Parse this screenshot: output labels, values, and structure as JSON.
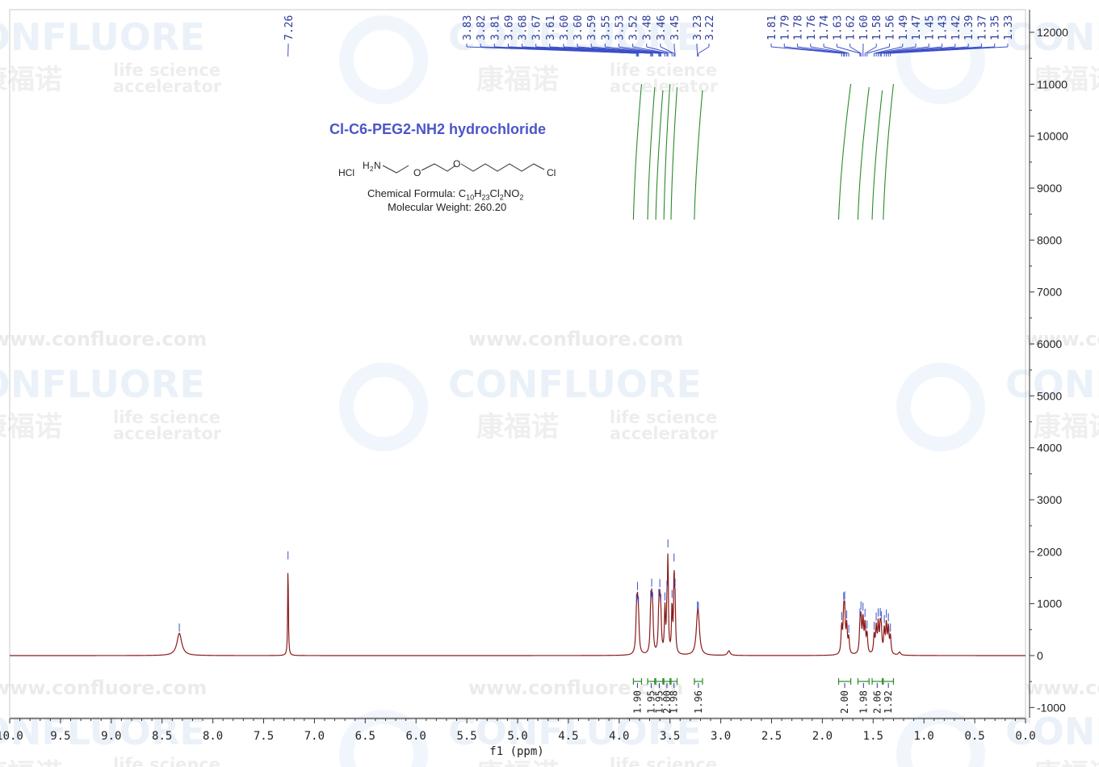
{
  "compound": {
    "title": "Cl-C6-PEG2-NH2 hydrochloride",
    "formula_prefix": "Chemical Formula: ",
    "formula_parts": [
      {
        "t": "C",
        "s": false
      },
      {
        "t": "10",
        "s": true
      },
      {
        "t": "H",
        "s": false
      },
      {
        "t": "23",
        "s": true
      },
      {
        "t": "Cl",
        "s": false
      },
      {
        "t": "2",
        "s": true
      },
      {
        "t": "NO",
        "s": false
      },
      {
        "t": "2",
        "s": true
      }
    ],
    "molecular_weight": "Molecular Weight: 260.20",
    "structure_labels": {
      "hcl": "HCl",
      "amine_h": "H",
      "amine_sub": "2",
      "amine_n": "N",
      "oxygen": "O",
      "chlorine": "Cl"
    }
  },
  "watermark": {
    "brand": "CONFLUORE",
    "url": "www.confluore.com",
    "tagline_1": "life science",
    "tagline_2": "accelerator",
    "chinese": "康福诺"
  },
  "chart_data": {
    "type": "line",
    "title": "",
    "xlabel": "f1 (ppm)",
    "ylabel": "",
    "xlim": [
      10.0,
      0.0
    ],
    "ylim": [
      -1200,
      12500
    ],
    "x_ticks": [
      "10.0",
      "9.5",
      "9.0",
      "8.5",
      "8.0",
      "7.5",
      "7.0",
      "6.5",
      "6.0",
      "5.5",
      "5.0",
      "4.5",
      "4.0",
      "3.5",
      "3.0",
      "2.5",
      "2.0",
      "1.5",
      "1.0",
      "0.5",
      "0.0"
    ],
    "y_ticks": [
      -1000,
      0,
      1000,
      2000,
      3000,
      4000,
      5000,
      6000,
      7000,
      8000,
      9000,
      10000,
      11000,
      12000
    ],
    "grid": false,
    "series": [
      {
        "color": "#8b1a1a",
        "peaks": [
          {
            "ppm": 8.33,
            "height": 430,
            "width": 0.028
          },
          {
            "ppm": 7.26,
            "height": 1820,
            "width": 0.004
          },
          {
            "ppm": 3.83,
            "height": 620,
            "width": 0.008
          },
          {
            "ppm": 3.82,
            "height": 760,
            "width": 0.008
          },
          {
            "ppm": 3.81,
            "height": 560,
            "width": 0.008
          },
          {
            "ppm": 3.69,
            "height": 700,
            "width": 0.007
          },
          {
            "ppm": 3.68,
            "height": 820,
            "width": 0.007
          },
          {
            "ppm": 3.67,
            "height": 650,
            "width": 0.007
          },
          {
            "ppm": 3.61,
            "height": 720,
            "width": 0.007
          },
          {
            "ppm": 3.6,
            "height": 800,
            "width": 0.007
          },
          {
            "ppm": 3.59,
            "height": 600,
            "width": 0.007
          },
          {
            "ppm": 3.55,
            "height": 850,
            "width": 0.006
          },
          {
            "ppm": 3.53,
            "height": 780,
            "width": 0.006
          },
          {
            "ppm": 3.52,
            "height": 1750,
            "width": 0.005
          },
          {
            "ppm": 3.48,
            "height": 900,
            "width": 0.006
          },
          {
            "ppm": 3.46,
            "height": 1420,
            "width": 0.005
          },
          {
            "ppm": 3.45,
            "height": 950,
            "width": 0.006
          },
          {
            "ppm": 3.23,
            "height": 520,
            "width": 0.015
          },
          {
            "ppm": 3.22,
            "height": 480,
            "width": 0.015
          },
          {
            "ppm": 2.92,
            "height": 90,
            "width": 0.015
          },
          {
            "ppm": 1.81,
            "height": 520,
            "width": 0.007
          },
          {
            "ppm": 1.79,
            "height": 700,
            "width": 0.007
          },
          {
            "ppm": 1.78,
            "height": 720,
            "width": 0.007
          },
          {
            "ppm": 1.76,
            "height": 520,
            "width": 0.007
          },
          {
            "ppm": 1.74,
            "height": 300,
            "width": 0.007
          },
          {
            "ppm": 1.63,
            "height": 460,
            "width": 0.007
          },
          {
            "ppm": 1.62,
            "height": 600,
            "width": 0.007
          },
          {
            "ppm": 1.6,
            "height": 660,
            "width": 0.007
          },
          {
            "ppm": 1.58,
            "height": 560,
            "width": 0.007
          },
          {
            "ppm": 1.56,
            "height": 380,
            "width": 0.007
          },
          {
            "ppm": 1.49,
            "height": 360,
            "width": 0.007
          },
          {
            "ppm": 1.47,
            "height": 500,
            "width": 0.007
          },
          {
            "ppm": 1.45,
            "height": 560,
            "width": 0.007
          },
          {
            "ppm": 1.43,
            "height": 480,
            "width": 0.007
          },
          {
            "ppm": 1.42,
            "height": 420,
            "width": 0.007
          },
          {
            "ppm": 1.39,
            "height": 460,
            "width": 0.007
          },
          {
            "ppm": 1.37,
            "height": 560,
            "width": 0.007
          },
          {
            "ppm": 1.35,
            "height": 500,
            "width": 0.007
          },
          {
            "ppm": 1.33,
            "height": 340,
            "width": 0.007
          },
          {
            "ppm": 1.24,
            "height": 60,
            "width": 0.012
          }
        ]
      }
    ],
    "peak_labels": {
      "group_1": [
        "7.26"
      ],
      "group_2": [
        "3.83",
        "3.82",
        "3.81",
        "3.69",
        "3.68",
        "3.67",
        "3.61",
        "3.60",
        "3.60",
        "3.59",
        "3.55",
        "3.53",
        "3.52",
        "3.48",
        "3.46",
        "3.45"
      ],
      "group_3": [
        "3.23",
        "3.22"
      ],
      "group_4": [
        "1.81",
        "1.79",
        "1.78",
        "1.76",
        "1.74",
        "1.63",
        "1.62",
        "1.60",
        "1.58",
        "1.56",
        "1.49",
        "1.47",
        "1.45",
        "1.43",
        "1.42",
        "1.39",
        "1.37",
        "1.35",
        "1.33"
      ]
    },
    "integrals": [
      {
        "from": 3.86,
        "to": 3.78,
        "value": "1.90"
      },
      {
        "from": 3.72,
        "to": 3.65,
        "value": "1.95"
      },
      {
        "from": 3.64,
        "to": 3.57,
        "value": "1.95"
      },
      {
        "from": 3.56,
        "to": 3.5,
        "value": "2.00"
      },
      {
        "from": 3.49,
        "to": 3.43,
        "value": "1.98"
      },
      {
        "from": 3.26,
        "to": 3.18,
        "value": "1.96"
      },
      {
        "from": 1.84,
        "to": 1.72,
        "value": "2.00"
      },
      {
        "from": 1.65,
        "to": 1.54,
        "value": "1.98"
      },
      {
        "from": 1.51,
        "to": 1.41,
        "value": "2.06"
      },
      {
        "from": 1.4,
        "to": 1.3,
        "value": "1.92"
      }
    ]
  }
}
